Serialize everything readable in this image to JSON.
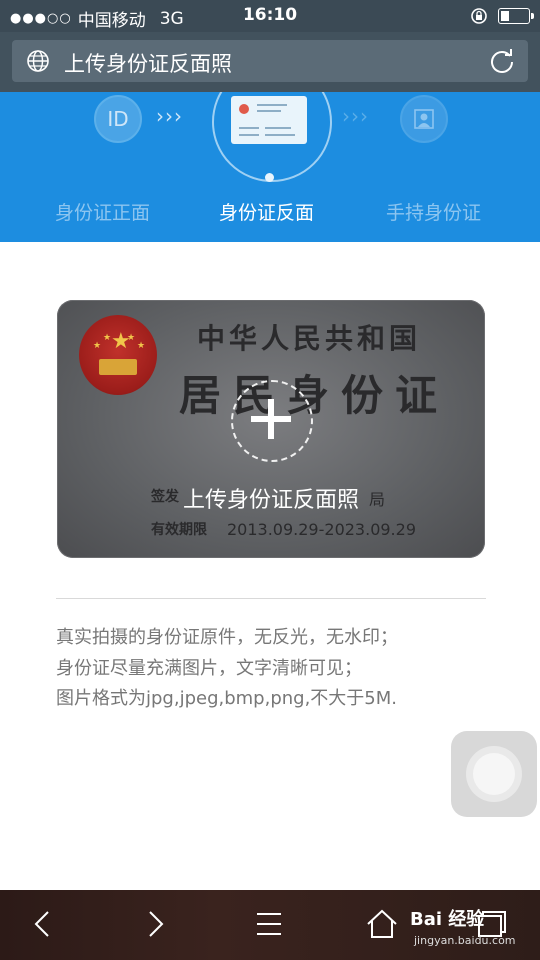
{
  "status_bar": {
    "carrier": "中国移动",
    "network": "3G",
    "time": "16:10"
  },
  "browser": {
    "page_title": "上传身份证反面照"
  },
  "steps": {
    "step1_icon_text": "ID",
    "arrows": "›››",
    "items": [
      {
        "label": "身份证正面",
        "active": false
      },
      {
        "label": "身份证反面",
        "active": true
      },
      {
        "label": "手持身份证",
        "active": false
      }
    ]
  },
  "id_card": {
    "title_line1": "中华人民共和国",
    "title_line2": "居民身份证",
    "sign_label": "签发",
    "authority_suffix": "局",
    "valid_label": "有效期限",
    "valid_value": "2013.09.29-2023.09.29",
    "upload_label": "上传身份证反面照"
  },
  "tips": [
    "真实拍摄的身份证原件，无反光，无水印；",
    "身份证尽量充满图片，文字清晰可见；",
    "图片格式为jpg,jpeg,bmp,png,不大于5M."
  ],
  "watermark": {
    "text": "Bai 经验",
    "sub": "jingyan.baidu.com"
  },
  "colors": {
    "accent": "#1d8de0",
    "status_bar": "#3b4a55",
    "toolbar": "#2c1a17"
  }
}
